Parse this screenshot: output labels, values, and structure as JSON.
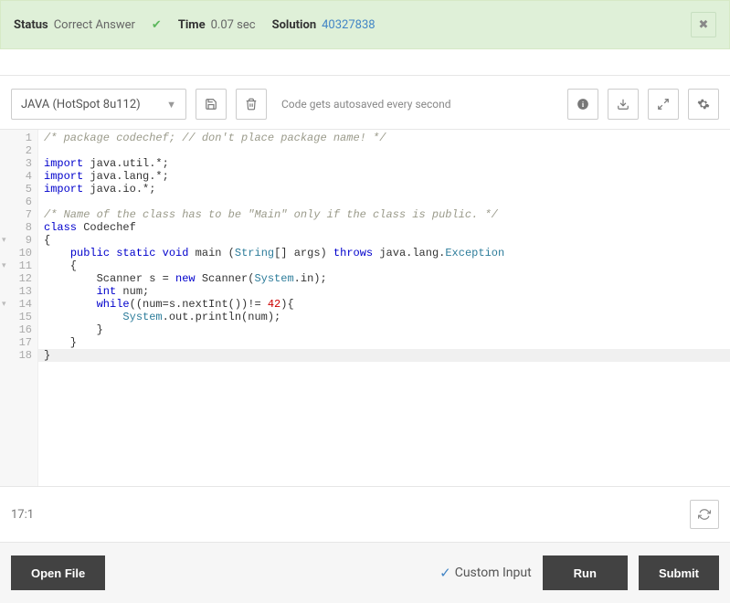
{
  "status": {
    "label_status": "Status",
    "value_status": "Correct Answer",
    "label_time": "Time",
    "value_time": "0.07 sec",
    "label_solution": "Solution",
    "solution_id": "40327838"
  },
  "toolbar": {
    "language": "JAVA (HotSpot 8u112)",
    "autosave_msg": "Code gets autosaved every second"
  },
  "code": {
    "lines": [
      {
        "n": 1,
        "tokens": [
          {
            "t": "/* package codechef; // don't place package name! */",
            "c": "c-comment"
          }
        ]
      },
      {
        "n": 2,
        "tokens": []
      },
      {
        "n": 3,
        "tokens": [
          {
            "t": "import",
            "c": "c-kw"
          },
          {
            "t": " java.util.*;",
            "c": "c-ident"
          }
        ]
      },
      {
        "n": 4,
        "tokens": [
          {
            "t": "import",
            "c": "c-kw"
          },
          {
            "t": " java.lang.*;",
            "c": "c-ident"
          }
        ]
      },
      {
        "n": 5,
        "tokens": [
          {
            "t": "import",
            "c": "c-kw"
          },
          {
            "t": " java.io.*;",
            "c": "c-ident"
          }
        ]
      },
      {
        "n": 6,
        "tokens": []
      },
      {
        "n": 7,
        "tokens": [
          {
            "t": "/* Name of the class has to be \"Main\" only if the class is public. */",
            "c": "c-comment"
          }
        ]
      },
      {
        "n": 8,
        "tokens": [
          {
            "t": "class",
            "c": "c-kw"
          },
          {
            "t": " ",
            "c": ""
          },
          {
            "t": "Codechef",
            "c": "c-ident"
          }
        ]
      },
      {
        "n": 9,
        "fold": true,
        "tokens": [
          {
            "t": "{",
            "c": ""
          }
        ]
      },
      {
        "n": 10,
        "tokens": [
          {
            "t": "    ",
            "c": ""
          },
          {
            "t": "public",
            "c": "c-kw"
          },
          {
            "t": " ",
            "c": ""
          },
          {
            "t": "static",
            "c": "c-kw"
          },
          {
            "t": " ",
            "c": ""
          },
          {
            "t": "void",
            "c": "c-kw"
          },
          {
            "t": " main (",
            "c": ""
          },
          {
            "t": "String",
            "c": "c-sys"
          },
          {
            "t": "[] args) ",
            "c": ""
          },
          {
            "t": "throws",
            "c": "c-kw"
          },
          {
            "t": " java.lang.",
            "c": ""
          },
          {
            "t": "Exception",
            "c": "c-sys"
          }
        ]
      },
      {
        "n": 11,
        "fold": true,
        "tokens": [
          {
            "t": "    {",
            "c": ""
          }
        ]
      },
      {
        "n": 12,
        "tokens": [
          {
            "t": "        Scanner s = ",
            "c": ""
          },
          {
            "t": "new",
            "c": "c-kw"
          },
          {
            "t": " Scanner(",
            "c": ""
          },
          {
            "t": "System",
            "c": "c-sys"
          },
          {
            "t": ".in);",
            "c": ""
          }
        ]
      },
      {
        "n": 13,
        "tokens": [
          {
            "t": "        ",
            "c": ""
          },
          {
            "t": "int",
            "c": "c-kw"
          },
          {
            "t": " num;",
            "c": ""
          }
        ]
      },
      {
        "n": 14,
        "fold": true,
        "tokens": [
          {
            "t": "        ",
            "c": ""
          },
          {
            "t": "while",
            "c": "c-kw"
          },
          {
            "t": "((num=s.nextInt())!= ",
            "c": ""
          },
          {
            "t": "42",
            "c": "c-num"
          },
          {
            "t": "){",
            "c": ""
          }
        ]
      },
      {
        "n": 15,
        "tokens": [
          {
            "t": "            ",
            "c": ""
          },
          {
            "t": "System",
            "c": "c-sys"
          },
          {
            "t": ".out.println(num);",
            "c": ""
          }
        ]
      },
      {
        "n": 16,
        "tokens": [
          {
            "t": "        }",
            "c": ""
          }
        ]
      },
      {
        "n": 17,
        "tokens": [
          {
            "t": "    }",
            "c": ""
          }
        ]
      },
      {
        "n": 18,
        "current": true,
        "tokens": [
          {
            "t": "}",
            "c": ""
          }
        ]
      }
    ]
  },
  "cursor": "17:1",
  "bottom": {
    "open_file": "Open File",
    "custom_input": "Custom Input",
    "run": "Run",
    "submit": "Submit"
  }
}
